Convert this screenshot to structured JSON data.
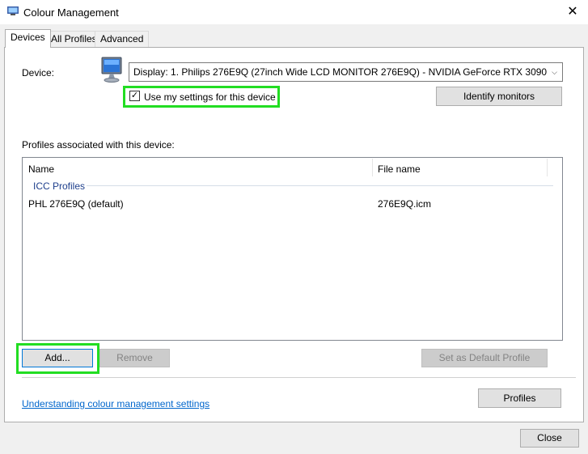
{
  "window": {
    "title": "Colour Management",
    "close_glyph": "✕"
  },
  "tabs": [
    {
      "label": "Devices",
      "active": true
    },
    {
      "label": "All Profiles",
      "active": false
    },
    {
      "label": "Advanced",
      "active": false
    }
  ],
  "device": {
    "label": "Device:",
    "selected": "Display: 1. Philips 276E9Q (27inch Wide LCD MONITOR 276E9Q) - NVIDIA GeForce RTX 3090",
    "icon": "monitor-icon",
    "use_my_settings_label": "Use my settings for this device",
    "use_my_settings_checked": true,
    "identify_button": "Identify monitors"
  },
  "profiles": {
    "section_label": "Profiles associated with this device:",
    "columns": [
      "Name",
      "File name"
    ],
    "group_label": "ICC Profiles",
    "rows": [
      {
        "name": "PHL 276E9Q (default)",
        "file": "276E9Q.icm"
      }
    ]
  },
  "actions": {
    "add": "Add...",
    "remove": "Remove",
    "set_default": "Set as Default Profile",
    "profiles": "Profiles"
  },
  "help_link": "Understanding colour management settings",
  "close_button": "Close",
  "colors": {
    "highlight": "#22dd22",
    "link": "#0066cc",
    "group": "#1e3f8c"
  }
}
